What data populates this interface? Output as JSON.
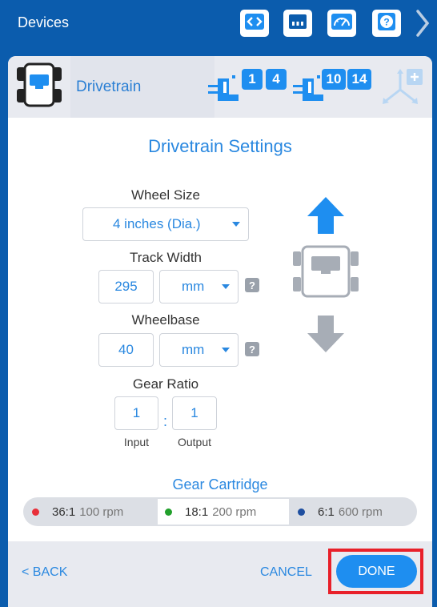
{
  "topbar": {
    "title": "Devices",
    "buttons": [
      {
        "icon": "code-icon"
      },
      {
        "icon": "port-icon"
      },
      {
        "icon": "dashboard-icon"
      },
      {
        "icon": "help-icon"
      }
    ],
    "next_icon": "chevron-right-icon"
  },
  "device": {
    "icon": "drivetrain-icon",
    "name": "Drivetrain",
    "motor_groups": [
      {
        "ports": [
          "1",
          "4"
        ]
      },
      {
        "ports": [
          "10",
          "14"
        ]
      }
    ],
    "add_sensor_icon": "add-gyro-icon"
  },
  "settings": {
    "title": "Drivetrain Settings",
    "wheel_size": {
      "label": "Wheel Size",
      "value": "4 inches (Dia.)"
    },
    "track_width": {
      "label": "Track Width",
      "value": "295",
      "unit": "mm",
      "help": "?"
    },
    "wheelbase": {
      "label": "Wheelbase",
      "value": "40",
      "unit": "mm",
      "help": "?"
    },
    "gear_ratio": {
      "label": "Gear Ratio",
      "input": "1",
      "output": "1",
      "separator": ":",
      "input_label": "Input",
      "output_label": "Output"
    }
  },
  "cartridge": {
    "title": "Gear Cartridge",
    "options": [
      {
        "ratio": "36:1",
        "rpm": "100 rpm",
        "color": "#e8303a",
        "selected": false
      },
      {
        "ratio": "18:1",
        "rpm": "200 rpm",
        "color": "#22a02c",
        "selected": true
      },
      {
        "ratio": "6:1",
        "rpm": "600 rpm",
        "color": "#1f4fa0",
        "selected": false
      }
    ]
  },
  "footer": {
    "back": "< BACK",
    "cancel": "CANCEL",
    "done": "DONE"
  },
  "colors": {
    "brand": "#0b5cad",
    "accent": "#2a88e0",
    "done_bg": "#1e8ef0",
    "highlight": "#e8202a"
  }
}
